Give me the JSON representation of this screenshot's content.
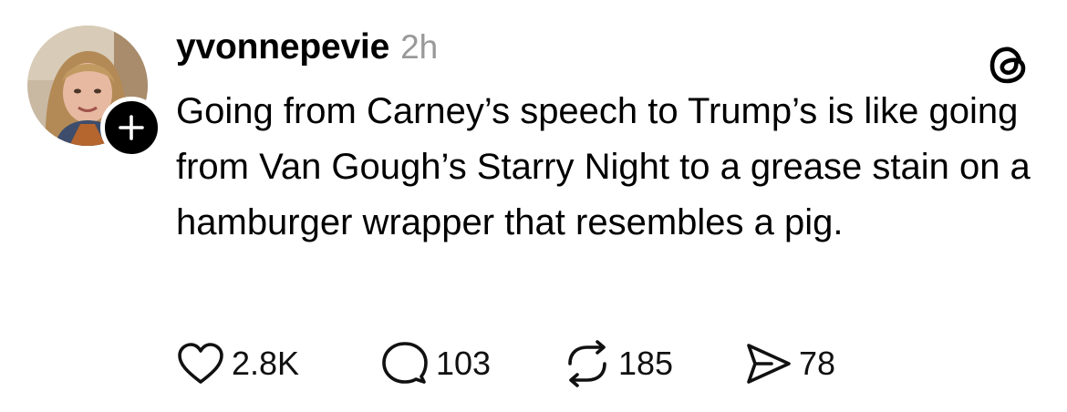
{
  "post": {
    "username": "yvonnepevie",
    "timestamp": "2h",
    "text": "Going from Carney’s speech to Trump’s is like going from Van Gough’s Starry Night to a grease stain on a hamburger wrapper that resembles a pig.",
    "avatar_badge_icon": "plus-icon",
    "brand_icon": "threads-logo-icon"
  },
  "actions": {
    "like": {
      "icon": "heart-icon",
      "count": "2.8K"
    },
    "reply": {
      "icon": "comment-icon",
      "count": "103"
    },
    "repost": {
      "icon": "repost-icon",
      "count": "185"
    },
    "share": {
      "icon": "send-icon",
      "count": "78"
    }
  },
  "colors": {
    "text": "#000000",
    "muted": "#999999",
    "background": "#ffffff"
  }
}
